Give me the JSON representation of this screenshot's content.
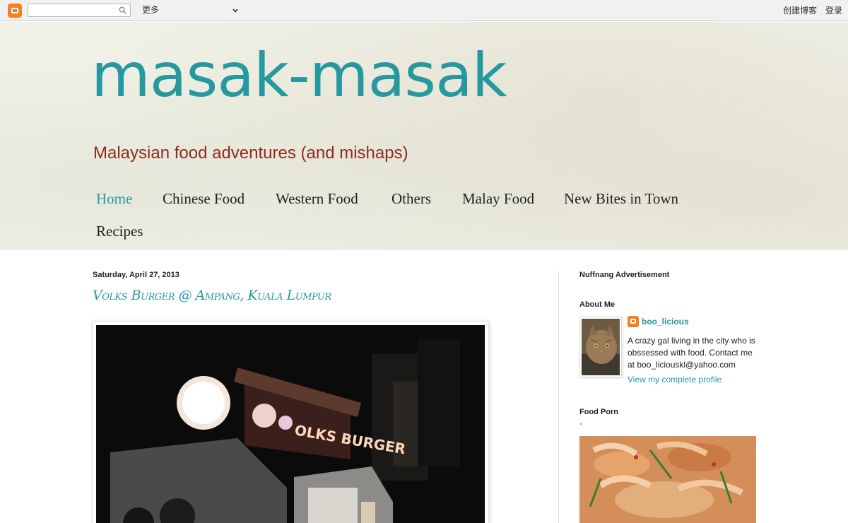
{
  "navbar": {
    "more_label": "更多",
    "create_blog": "创建博客",
    "sign_in": "登录"
  },
  "header": {
    "title": "masak-masak",
    "description": "Malaysian food adventures (and mishaps)",
    "tabs": [
      {
        "label": "Home",
        "active": true
      },
      {
        "label": "Chinese Food"
      },
      {
        "label": "Western Food"
      },
      {
        "label": "Others"
      },
      {
        "label": "Malay Food"
      },
      {
        "label": "New Bites in Town"
      },
      {
        "label": "Recipes"
      }
    ]
  },
  "post": {
    "date": "Saturday, April 27, 2013",
    "title": "Volks Burger @ Ampang, Kuala Lumpur",
    "image_sign_text": "OLKS BURGER"
  },
  "sidebar": {
    "ad_heading": "Nuffnang Advertisement",
    "about_heading": "About Me",
    "profile_name": "boo_licious",
    "profile_desc": "A crazy gal living in the city who is obssessed with food. Contact me at boo_liciouskl@yahoo.com",
    "profile_link": "View my complete profile",
    "food_heading": "Food Porn",
    "food_quote": "\""
  },
  "colors": {
    "accent": "#2699a0",
    "subtitle": "#8e2a20",
    "blogger_orange": "#f48120"
  }
}
